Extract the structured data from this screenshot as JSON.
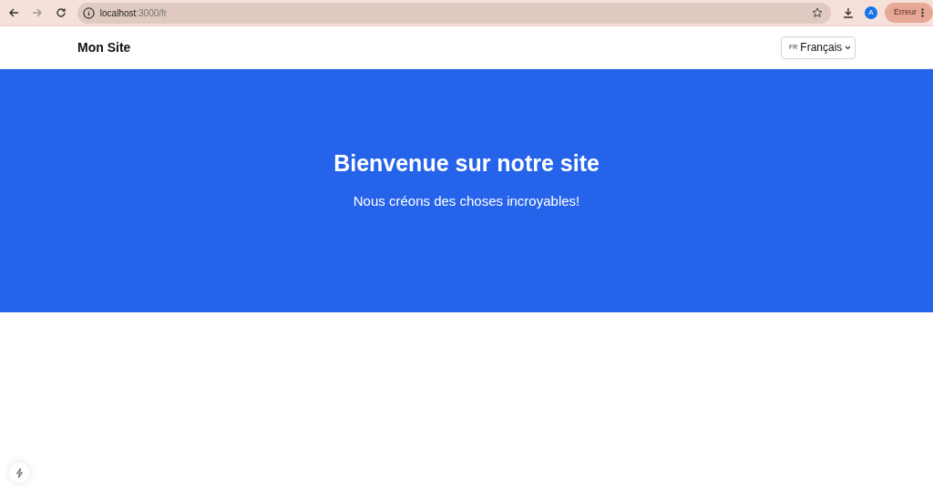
{
  "browser": {
    "url_host": "localhost",
    "url_path": ":3000/fr",
    "profile_initial": "A",
    "error_button": "Erreur"
  },
  "navbar": {
    "logo": "Mon Site",
    "language": {
      "code": "FR",
      "label": "Français"
    }
  },
  "hero": {
    "title": "Bienvenue sur notre site",
    "subtitle": "Nous créons des choses incroyables!"
  }
}
